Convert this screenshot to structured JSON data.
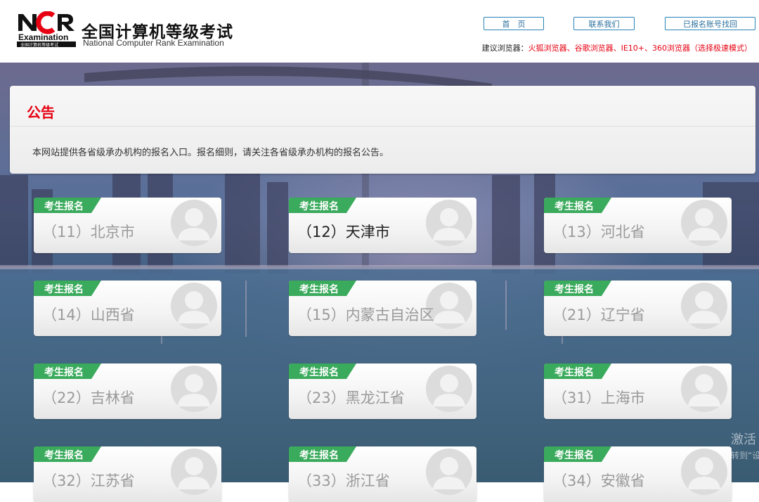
{
  "header": {
    "logo_mark": "NCR",
    "logo_badge": "Examination",
    "logo_small": "全国计算机等级考试",
    "title": "全国计算机等级考试",
    "subtitle": "National Computer Rank Examination",
    "nav": {
      "home": "首　页",
      "contact": "联系我们",
      "recover": "已报名账号找回"
    },
    "browser_tip_label": "建议浏览器：",
    "browser_tip_value": "火狐浏览器、谷歌浏览器、IE10+、360浏览器（选择极速模式）"
  },
  "notice": {
    "title": "公告",
    "body": "本网站提供各省级承办机构的报名入口。报名细则，请关注各省级承办机构的报名公告。"
  },
  "cards": [
    {
      "tag": "考生报名",
      "name": "（11）北京市",
      "active": false
    },
    {
      "tag": "考生报名",
      "name": "（12）天津市",
      "active": true
    },
    {
      "tag": "考生报名",
      "name": "（13）河北省",
      "active": false
    },
    {
      "tag": "考生报名",
      "name": "（14）山西省",
      "active": false
    },
    {
      "tag": "考生报名",
      "name": "（15）内蒙古自治区",
      "active": false
    },
    {
      "tag": "考生报名",
      "name": "（21）辽宁省",
      "active": false
    },
    {
      "tag": "考生报名",
      "name": "（22）吉林省",
      "active": false
    },
    {
      "tag": "考生报名",
      "name": "（23）黑龙江省",
      "active": false
    },
    {
      "tag": "考生报名",
      "name": "（31）上海市",
      "active": false
    },
    {
      "tag": "考生报名",
      "name": "（32）江苏省",
      "active": false
    },
    {
      "tag": "考生报名",
      "name": "（33）浙江省",
      "active": false
    },
    {
      "tag": "考生报名",
      "name": "（34）安徽省",
      "active": false
    }
  ],
  "watermark": {
    "line1": "激活",
    "line2": "转到“设"
  },
  "icons": {
    "card_avatar": "user-avatar-icon",
    "tag_shape": "green-ribbon-icon"
  },
  "colors": {
    "accent_red": "#e60012",
    "tag_green": "#3aaa5c",
    "nav_blue": "#2a84b8"
  }
}
